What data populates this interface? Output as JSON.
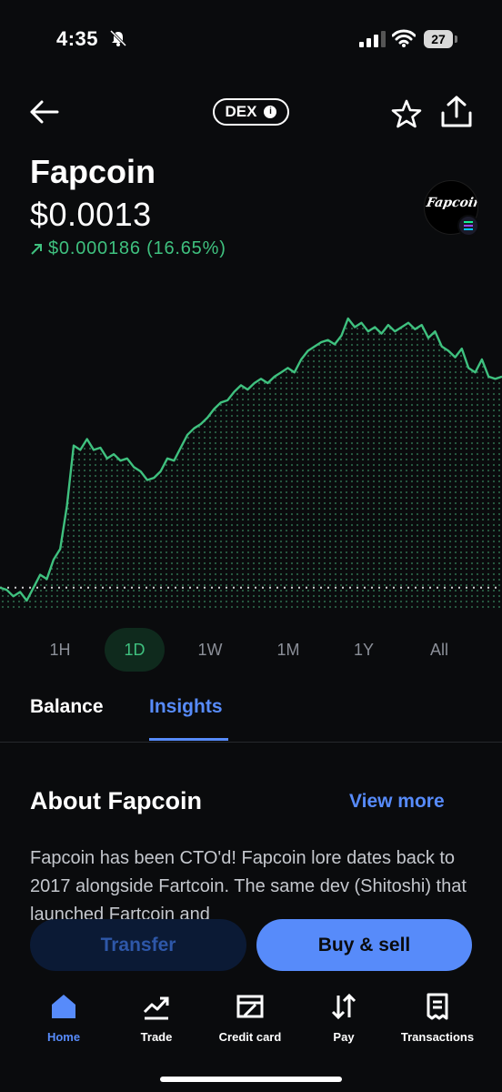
{
  "status_bar": {
    "time": "4:35",
    "battery": "27"
  },
  "header": {
    "badge": "DEX",
    "info_glyph": "i"
  },
  "asset": {
    "name": "Fapcoin",
    "price": "$0.0013",
    "change": "$0.000186 (16.65%)",
    "change_color": "#3fc17f",
    "logo_text": "Fapcoin"
  },
  "chart_data": {
    "type": "area",
    "color": "#3fc17f",
    "baseline_dotted": true,
    "series": [
      {
        "values": [
          0.00112,
          0.00111,
          0.00108,
          0.0011,
          0.00106,
          0.00112,
          0.00118,
          0.00116,
          0.00125,
          0.0013,
          0.0015,
          0.00178,
          0.00176,
          0.00181,
          0.00176,
          0.00177,
          0.00172,
          0.00174,
          0.00171,
          0.00172,
          0.00168,
          0.00166,
          0.00162,
          0.00163,
          0.00166,
          0.00172,
          0.00171,
          0.00177,
          0.00183,
          0.00186,
          0.00188,
          0.00191,
          0.00195,
          0.00198,
          0.00199,
          0.00203,
          0.00206,
          0.00204,
          0.00207,
          0.00209,
          0.00207,
          0.0021,
          0.00212,
          0.00214,
          0.00212,
          0.00218,
          0.00222,
          0.00224,
          0.00226,
          0.00227,
          0.00225,
          0.00229,
          0.00237,
          0.00233,
          0.00235,
          0.00231,
          0.00233,
          0.0023,
          0.00234,
          0.00231,
          0.00233,
          0.00235,
          0.00232,
          0.00234,
          0.00228,
          0.00231,
          0.00224,
          0.00222,
          0.00219,
          0.00223,
          0.00214,
          0.00212,
          0.00218,
          0.0021,
          0.00209,
          0.0021
        ]
      }
    ]
  },
  "ranges": [
    "1H",
    "1D",
    "1W",
    "1M",
    "1Y",
    "All"
  ],
  "active_range": "1D",
  "tabs": {
    "balance": "Balance",
    "insights": "Insights"
  },
  "about": {
    "title": "About Fapcoin",
    "view_more": "View more",
    "text": "Fapcoin has been CTO'd! Fapcoin lore dates back to 2017 alongside Fartcoin. The same dev (Shitoshi) that launched Fartcoin and"
  },
  "actions": {
    "transfer": "Transfer",
    "buy_sell": "Buy & sell"
  },
  "nav": {
    "home": "Home",
    "trade": "Trade",
    "credit_card": "Credit card",
    "pay": "Pay",
    "transactions": "Transactions"
  },
  "colors": {
    "accent": "#578bfa",
    "positive": "#3fc17f",
    "background": "#0a0b0d"
  }
}
